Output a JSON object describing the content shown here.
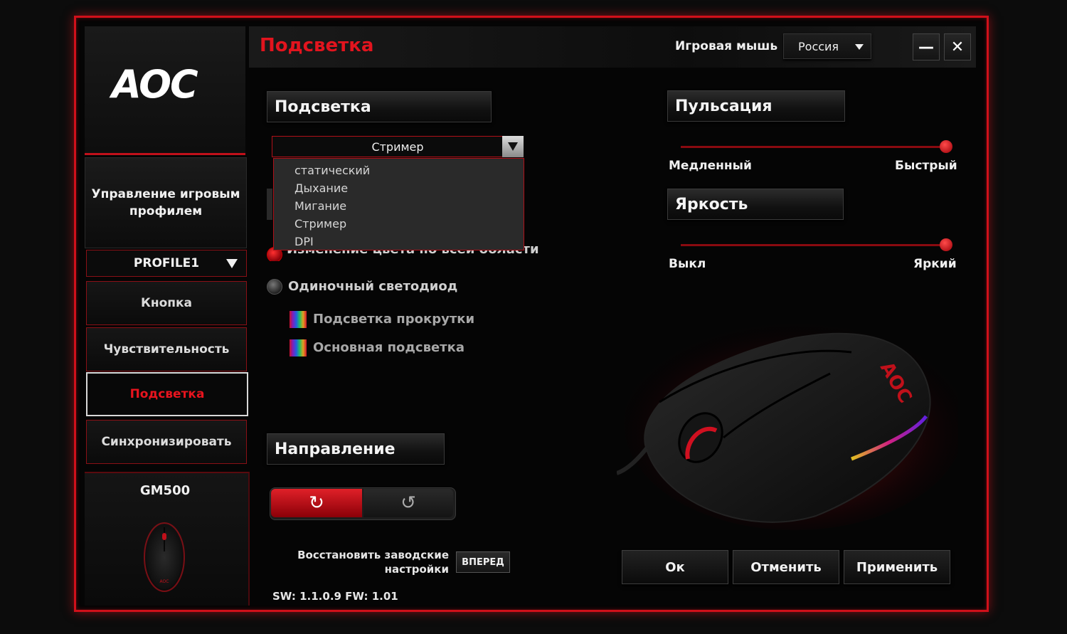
{
  "header": {
    "title": "Подсветка",
    "device_label": "Игровая мышь",
    "language": "Россия",
    "minimize_glyph": "—",
    "close_glyph": "✕"
  },
  "sidebar": {
    "logo": "AOC",
    "profile_management": "Управление игровым профилем",
    "profile": "PROFILE1",
    "items": [
      {
        "label": "Кнопка",
        "active": false
      },
      {
        "label": "Чувствительность",
        "active": false
      },
      {
        "label": "Подсветка",
        "active": true
      },
      {
        "label": "Синхронизировать",
        "active": false
      }
    ],
    "model": "GM500"
  },
  "lighting": {
    "section_label": "Подсветка",
    "mode_selected": "Стример",
    "mode_options": [
      "статический",
      "Дыхание",
      "Мигание",
      "Стример",
      "DPI"
    ],
    "area_option": "Изменение цвета по всей области",
    "single_led_option": "Одиночный светодиод",
    "scroll_light": "Подсветка прокрутки",
    "main_light": "Основная подсветка"
  },
  "pulse": {
    "section_label": "Пульсация",
    "min_label": "Медленный",
    "max_label": "Быстрый",
    "value": 1.0
  },
  "brightness": {
    "section_label": "Яркость",
    "min_label": "Выкл",
    "max_label": "Яркий",
    "value": 1.0
  },
  "direction": {
    "section_label": "Направление",
    "cw_glyph": "↻",
    "ccw_glyph": "↺",
    "selected": "cw"
  },
  "reset": {
    "label": "Восстановить заводские настройки",
    "button": "ВПЕРЕД"
  },
  "version": "SW: 1.1.0.9   FW: 1.01",
  "actions": {
    "ok": "Ок",
    "cancel": "Отменить",
    "apply": "Применить"
  },
  "colors": {
    "accent": "#e2141e",
    "border": "#d0101a"
  }
}
